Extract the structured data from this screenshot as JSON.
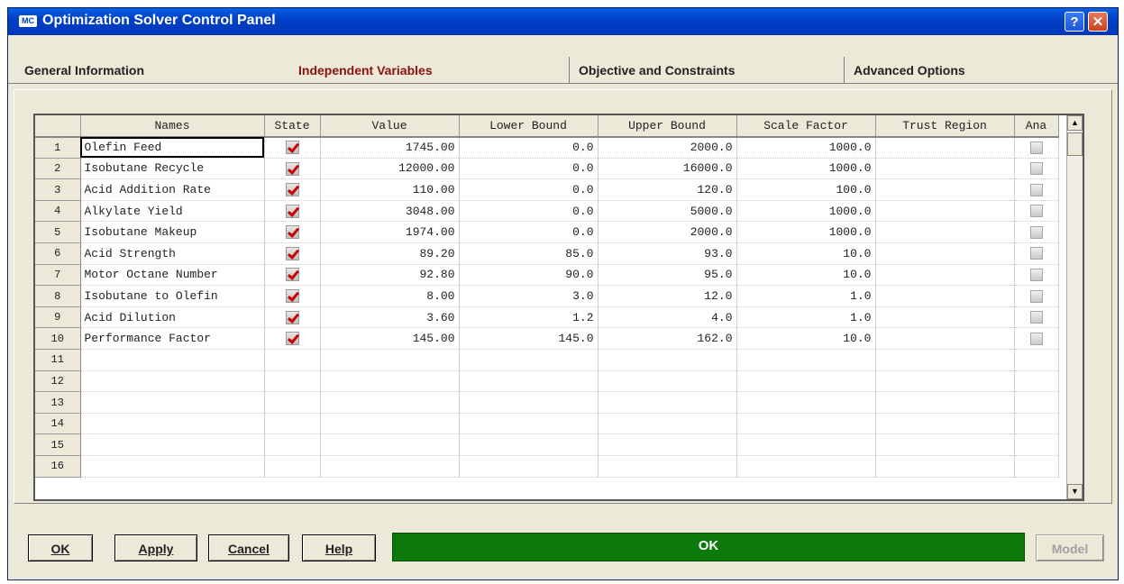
{
  "window": {
    "title": "Optimization Solver Control Panel",
    "icon_text": "MC",
    "help_glyph": "?",
    "close_glyph": "✕"
  },
  "tabs": [
    {
      "label": "General Information"
    },
    {
      "label": "Independent Variables",
      "active": true
    },
    {
      "label": "Objective and Constraints"
    },
    {
      "label": "Advanced Options"
    }
  ],
  "grid": {
    "columns": [
      "Names",
      "State",
      "Value",
      "Lower Bound",
      "Upper Bound",
      "Scale Factor",
      "Trust Region",
      "Ana"
    ],
    "rows": [
      {
        "num": "1",
        "name": "Olefin Feed",
        "state": true,
        "value": "1745.00",
        "lower": "0.0",
        "upper": "2000.0",
        "scale": "1000.0",
        "trust": ""
      },
      {
        "num": "2",
        "name": "Isobutane Recycle",
        "state": true,
        "value": "12000.00",
        "lower": "0.0",
        "upper": "16000.0",
        "scale": "1000.0",
        "trust": ""
      },
      {
        "num": "3",
        "name": "Acid Addition Rate",
        "state": true,
        "value": "110.00",
        "lower": "0.0",
        "upper": "120.0",
        "scale": "100.0",
        "trust": ""
      },
      {
        "num": "4",
        "name": "Alkylate Yield",
        "state": true,
        "value": "3048.00",
        "lower": "0.0",
        "upper": "5000.0",
        "scale": "1000.0",
        "trust": ""
      },
      {
        "num": "5",
        "name": "Isobutane Makeup",
        "state": true,
        "value": "1974.00",
        "lower": "0.0",
        "upper": "2000.0",
        "scale": "1000.0",
        "trust": ""
      },
      {
        "num": "6",
        "name": "Acid Strength",
        "state": true,
        "value": "89.20",
        "lower": "85.0",
        "upper": "93.0",
        "scale": "10.0",
        "trust": ""
      },
      {
        "num": "7",
        "name": "Motor Octane Number",
        "state": true,
        "value": "92.80",
        "lower": "90.0",
        "upper": "95.0",
        "scale": "10.0",
        "trust": ""
      },
      {
        "num": "8",
        "name": "Isobutane to Olefin",
        "state": true,
        "value": "8.00",
        "lower": "3.0",
        "upper": "12.0",
        "scale": "1.0",
        "trust": ""
      },
      {
        "num": "9",
        "name": "Acid Dilution",
        "state": true,
        "value": "3.60",
        "lower": "1.2",
        "upper": "4.0",
        "scale": "1.0",
        "trust": ""
      },
      {
        "num": "10",
        "name": "Performance Factor",
        "state": true,
        "value": "145.00",
        "lower": "145.0",
        "upper": "162.0",
        "scale": "10.0",
        "trust": ""
      },
      {
        "num": "11",
        "empty": true
      },
      {
        "num": "12",
        "empty": true
      },
      {
        "num": "13",
        "empty": true
      },
      {
        "num": "14",
        "empty": true
      },
      {
        "num": "15",
        "empty": true
      },
      {
        "num": "16",
        "empty": true
      }
    ]
  },
  "scrollbar": {
    "up_glyph": "▲",
    "down_glyph": "▼"
  },
  "buttons": {
    "ok": "OK",
    "apply": "Apply",
    "cancel": "Cancel",
    "help": "Help",
    "model": "Model"
  },
  "status": {
    "text": "OK",
    "color": "#0b7a0b"
  }
}
